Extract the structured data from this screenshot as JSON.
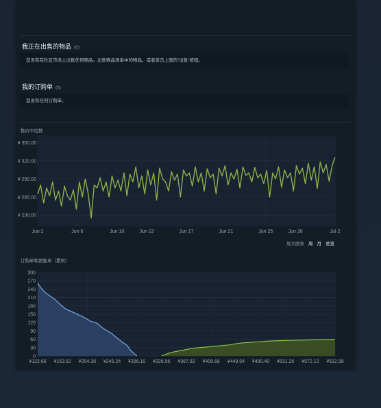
{
  "selling": {
    "title": "我正在出售的物品",
    "count": "(0)",
    "message": "您没有在社区市场上出售任何物品。出售物品清单中的物品，或者单击上面的“出售”按钮。"
  },
  "orders": {
    "title": "我的订购单",
    "count": "(0)",
    "message": "您没有任何订购单。"
  },
  "zoom": {
    "label": "放大图表",
    "options": [
      "周",
      "月",
      "总览"
    ]
  },
  "colors": {
    "price_line": "#8db14a",
    "buy_fill": "#2e4467",
    "buy_line": "#6fa5d6",
    "sell_fill": "#3b4f24",
    "sell_line": "#8bc34a"
  },
  "chart_data": [
    {
      "type": "line",
      "title": "售价中位数",
      "y_ticks": [
        "¥ 350.00",
        "¥ 320.00",
        "¥ 290.00",
        "¥ 260.00",
        "¥ 230.00"
      ],
      "y_tick_values": [
        350,
        320,
        290,
        260,
        230
      ],
      "ylim": [
        212,
        362
      ],
      "x_ticks": [
        "Jun 2",
        "Jun 6",
        "Jun 10",
        "Jun 13",
        "Jun 17",
        "Jun 21",
        "Jun 25",
        "Jun 28",
        "Jul 2"
      ],
      "x_tick_days": [
        0,
        4,
        8,
        11,
        15,
        19,
        23,
        26,
        30
      ],
      "series": [
        {
          "days": [
            0,
            0.3,
            0.6,
            0.9,
            1.2,
            1.5,
            1.8,
            2.1,
            2.4,
            2.7,
            3,
            3.3,
            3.6,
            3.9,
            4.2,
            4.5,
            4.8,
            5.1,
            5.4,
            5.7,
            6,
            6.3,
            6.6,
            6.9,
            7.2,
            7.5,
            7.8,
            8.1,
            8.4,
            8.7,
            9,
            9.3,
            9.6,
            9.9,
            10.2,
            10.5,
            10.8,
            11.1,
            11.4,
            11.7,
            12,
            12.3,
            12.6,
            12.9,
            13.2,
            13.5,
            13.8,
            14.1,
            14.4,
            14.7,
            15,
            15.3,
            15.6,
            15.9,
            16.2,
            16.5,
            16.8,
            17.1,
            17.4,
            17.7,
            18,
            18.3,
            18.6,
            18.9,
            19.2,
            19.5,
            19.8,
            20.1,
            20.4,
            20.7,
            21,
            21.3,
            21.6,
            21.9,
            22.2,
            22.5,
            22.8,
            23.1,
            23.4,
            23.7,
            24,
            24.3,
            24.6,
            24.9,
            25.2,
            25.5,
            25.8,
            26.1,
            26.4,
            26.7,
            27,
            27.3,
            27.6,
            27.9,
            28.2,
            28.5,
            28.8,
            29.1,
            29.4,
            29.7,
            30
          ],
          "values": [
            265,
            280,
            250,
            275,
            262,
            285,
            255,
            270,
            245,
            278,
            262,
            255,
            272,
            240,
            285,
            260,
            290,
            265,
            225,
            280,
            275,
            292,
            270,
            285,
            260,
            295,
            275,
            288,
            270,
            300,
            262,
            298,
            285,
            310,
            275,
            295,
            265,
            305,
            280,
            300,
            255,
            308,
            290,
            285,
            270,
            302,
            288,
            298,
            260,
            305,
            295,
            300,
            278,
            310,
            285,
            300,
            270,
            307,
            292,
            298,
            265,
            308,
            295,
            312,
            280,
            300,
            290,
            306,
            275,
            310,
            296,
            300,
            285,
            309,
            292,
            298,
            282,
            304,
            260,
            300,
            290,
            310,
            276,
            305,
            292,
            300,
            270,
            312,
            298,
            308,
            282,
            316,
            288,
            310,
            274,
            318,
            300,
            314,
            286,
            312,
            326
          ]
        }
      ]
    },
    {
      "type": "area",
      "title": "订购单和销售单（累积）",
      "y_ticks": [
        "300",
        "270",
        "240",
        "210",
        "180",
        "150",
        "120",
        "90",
        "60",
        "30",
        "0"
      ],
      "y_tick_values": [
        300,
        270,
        240,
        210,
        180,
        150,
        120,
        90,
        60,
        30,
        0
      ],
      "ylim": [
        0,
        300
      ],
      "x_ticks": [
        "¥122.66",
        "¥163.52",
        "¥204.38",
        "¥245.24",
        "¥286.10",
        "¥326.96",
        "¥367.82",
        "¥408.68",
        "¥449.54",
        "¥490.40",
        "¥531.26",
        "¥572.12",
        "¥612.98"
      ],
      "xlim": [
        122.66,
        612.98
      ],
      "series": [
        {
          "price": [
            122.66,
            128,
            135,
            140,
            150,
            160,
            168,
            178,
            188,
            198,
            210,
            220,
            230,
            236,
            245,
            255,
            262,
            270,
            276,
            282,
            286.1
          ],
          "qty": [
            262,
            245,
            228,
            220,
            205,
            185,
            170,
            160,
            150,
            140,
            125,
            118,
            100,
            92,
            80,
            62,
            50,
            38,
            20,
            8,
            0
          ]
        },
        {
          "price": [
            326.96,
            332,
            338,
            342,
            350,
            360,
            370,
            380,
            395,
            410,
            425,
            440,
            452,
            465,
            480,
            500,
            520,
            540,
            560,
            580,
            600,
            612.98
          ],
          "qty": [
            0,
            5,
            9,
            12,
            16,
            20,
            24,
            28,
            31,
            34,
            37,
            40,
            45,
            48,
            50,
            53,
            55,
            56,
            57,
            58,
            59,
            60
          ]
        }
      ]
    }
  ]
}
